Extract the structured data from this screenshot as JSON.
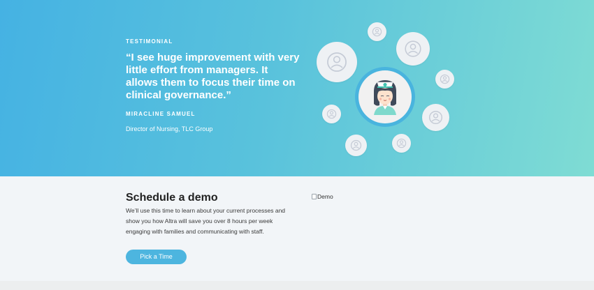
{
  "testimonial": {
    "eyebrow": "TESTIMONIAL",
    "quote": "“I see huge improvement with very little effort from managers. It allows them to focus their time on clinical governance.”",
    "author": "MIRACLINE SAMUEL",
    "role": "Director of Nursing, TLC Group"
  },
  "schedule": {
    "title": "Schedule a demo",
    "body": "We’ll use this time to learn about your current processes and show you how Altra will save you over 8 hours per week engaging with families and communicating with staff.",
    "button_label": "Pick a Time",
    "image_alt": "Demo"
  },
  "icons": {
    "avatar": "user-avatar-icon",
    "nurse": "nurse-illustration",
    "broken_image": "broken-image-icon"
  },
  "colors": {
    "hero_start": "#45b2e3",
    "hero_end": "#7fdcd4",
    "accent": "#4db5df",
    "lower_bg": "#f2f5f8"
  }
}
